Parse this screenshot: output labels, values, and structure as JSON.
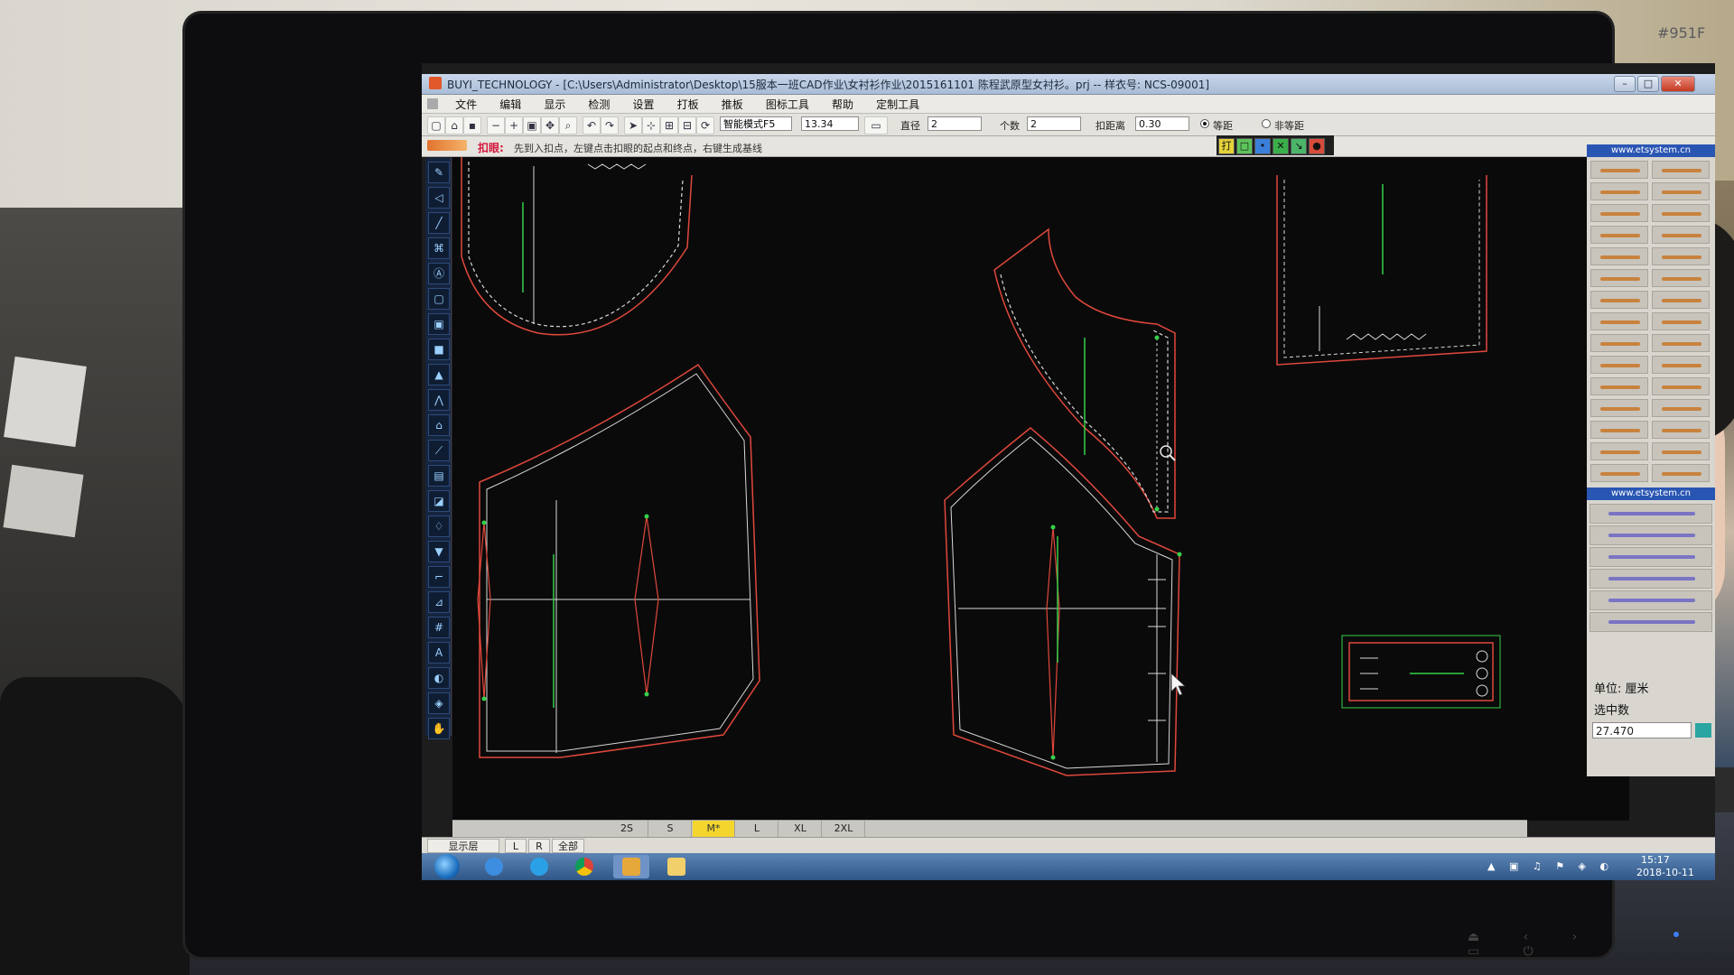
{
  "window": {
    "app_name": "BUYI_TECHNOLOGY",
    "title": "BUYI_TECHNOLOGY - [C:\\Users\\Administrator\\Desktop\\15服本一班CAD作业\\女衬衫作业\\2015161101 陈程武原型女衬衫。prj -- 样衣号: NCS-09001]"
  },
  "monitor": {
    "model": "#951F"
  },
  "menu": [
    "文件",
    "编辑",
    "显示",
    "检测",
    "设置",
    "打板",
    "推板",
    "图标工具",
    "帮助",
    "定制工具"
  ],
  "toolbar": {
    "mode_select": "智能模式F5",
    "length_value": "13.34",
    "diameter_label": "直径",
    "diameter_value": "2",
    "count_label": "个数",
    "count_value": "2",
    "spacing_label": "扣距离",
    "spacing_value": "0.30",
    "radio_equal": "等距",
    "radio_unequal": "非等距",
    "radio_selected": "等距"
  },
  "hint": {
    "tool_name": "扣眼:",
    "text": "先到入扣点，左键点击扣眼的起点和终点，右键生成基线"
  },
  "mode_buttons": [
    "打",
    "□",
    "•",
    "✕",
    "↘",
    "●"
  ],
  "right_panel": {
    "header_top": "www.etsystem.cn",
    "header_mid": "www.etsystem.cn",
    "unit_label": "单位: 厘米",
    "selected_label": "选中数",
    "measure_value": "27.470"
  },
  "size_bar": {
    "sizes": [
      "2S",
      "S",
      "M*",
      "L",
      "XL",
      "2XL"
    ],
    "active": "M*"
  },
  "status_bar": {
    "layer_button": "显示层",
    "left_button": "L",
    "right_button": "R",
    "all_button": "全部"
  },
  "taskbar": {
    "apps": [
      "start",
      "ie-browser",
      "qq-browser",
      "chrome",
      "cad-app",
      "file-explorer"
    ],
    "time": "15:17",
    "date": "2018-10-11"
  },
  "colors": {
    "outline_red": "#e0483c",
    "seam_white": "#d8d8d8",
    "grain_green": "#35d04a",
    "canvas_bg": "#0a0a0a",
    "size_active": "#f4d52d",
    "panel_header": "#2a56b3"
  }
}
